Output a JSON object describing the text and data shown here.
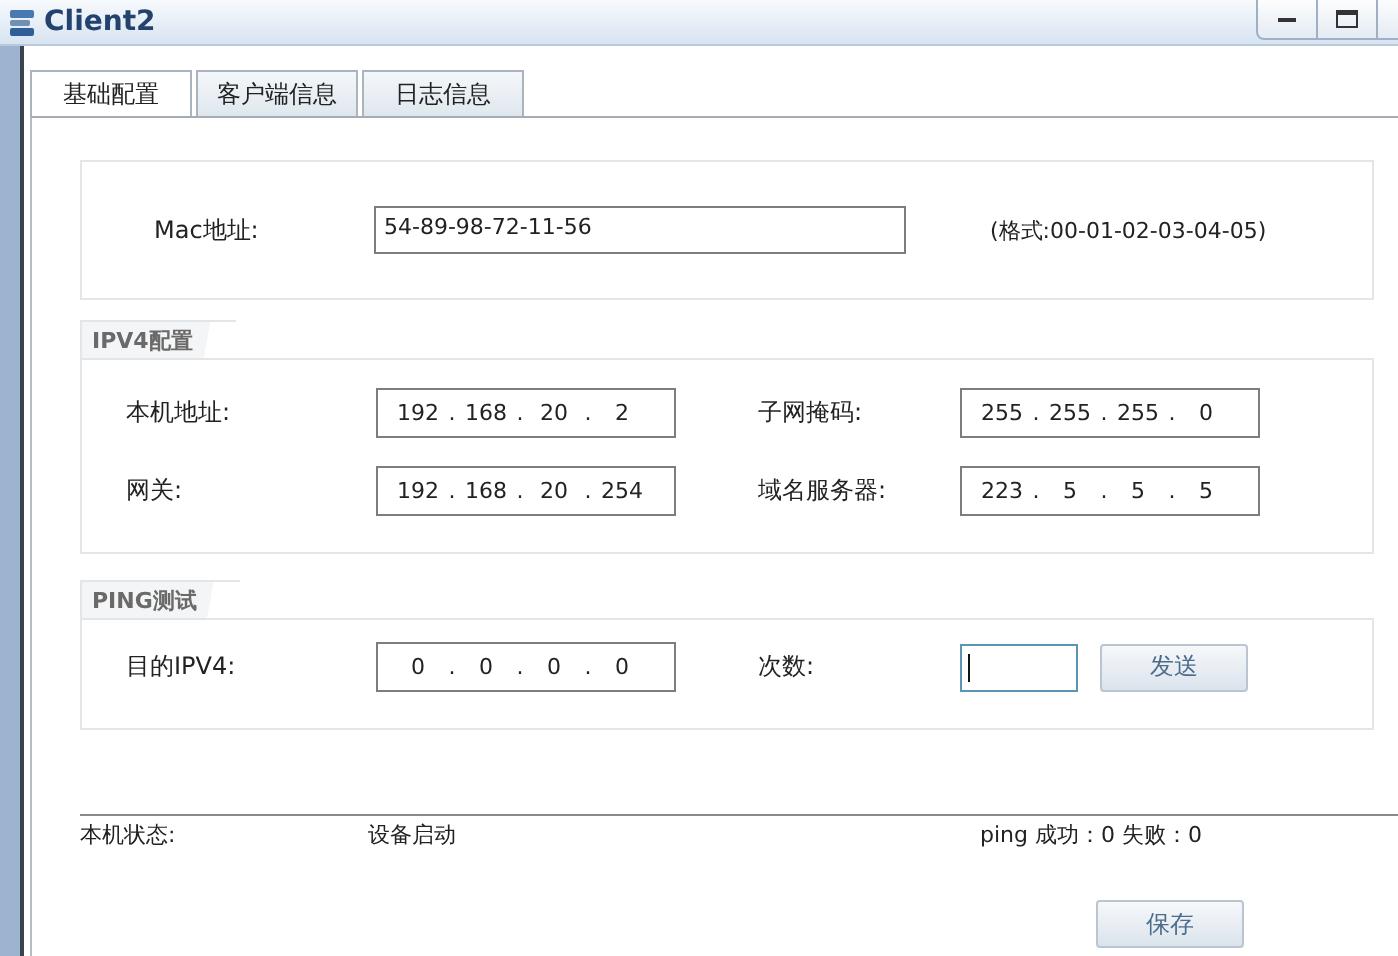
{
  "window": {
    "title": "Client2"
  },
  "tabs": [
    {
      "label": "基础配置",
      "selected": true
    },
    {
      "label": "客户端信息",
      "selected": false
    },
    {
      "label": "日志信息",
      "selected": false
    }
  ],
  "octet_separator": ".",
  "mac": {
    "label": "Mac地址:",
    "value": "54-89-98-72-11-56",
    "hint": "(格式:00-01-02-03-04-05)"
  },
  "ipv4": {
    "title": "IPV4配置",
    "fields": [
      {
        "label": "本机地址:",
        "octets": [
          "192",
          "168",
          "20",
          "2"
        ]
      },
      {
        "label": "子网掩码:",
        "octets": [
          "255",
          "255",
          "255",
          "0"
        ]
      },
      {
        "label": "网关:",
        "octets": [
          "192",
          "168",
          "20",
          "254"
        ]
      },
      {
        "label": "域名服务器:",
        "octets": [
          "223",
          "5",
          "5",
          "5"
        ]
      }
    ]
  },
  "ping": {
    "title": "PING测试",
    "target": {
      "label": "目的IPV4:",
      "octets": [
        "0",
        "0",
        "0",
        "0"
      ]
    },
    "count": {
      "label": "次数:",
      "focused": true
    },
    "send_button": "发送"
  },
  "status": {
    "label": "本机状态:",
    "value": "设备启动",
    "ping_result": "ping 成功：0 失败：0"
  },
  "save_button": "保存"
}
